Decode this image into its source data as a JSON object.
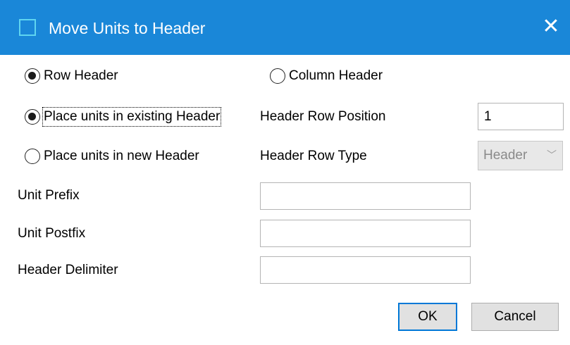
{
  "window": {
    "title": "Move Units to Header",
    "close_glyph": "✕"
  },
  "header_type": {
    "row_header_label": "Row Header",
    "column_header_label": "Column Header",
    "selected": "Row Header"
  },
  "placement": {
    "existing_label": "Place units in existing Header",
    "new_label": "Place units in new Header",
    "selected": "Place units in existing Header"
  },
  "header_row_position": {
    "label": "Header Row Position",
    "value": "1"
  },
  "header_row_type": {
    "label": "Header Row Type",
    "value": "Header",
    "enabled": false
  },
  "unit_prefix": {
    "label": "Unit Prefix",
    "value": ""
  },
  "unit_postfix": {
    "label": "Unit Postfix",
    "value": ""
  },
  "header_delimiter": {
    "label": "Header Delimiter",
    "value": ""
  },
  "buttons": {
    "ok": "OK",
    "cancel": "Cancel"
  },
  "colors": {
    "titlebar": "#1a87d8",
    "primary_border": "#0078d7"
  }
}
